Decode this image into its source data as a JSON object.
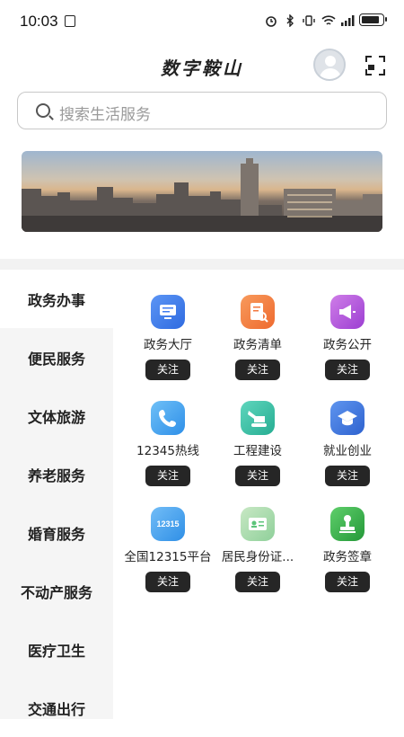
{
  "status": {
    "time": "10:03"
  },
  "header": {
    "title": "数字鞍山"
  },
  "search": {
    "placeholder": "搜索生活服务"
  },
  "sidebar": {
    "items": [
      {
        "label": "政务办事",
        "active": true
      },
      {
        "label": "便民服务"
      },
      {
        "label": "文体旅游"
      },
      {
        "label": "养老服务"
      },
      {
        "label": "婚育服务"
      },
      {
        "label": "不动产服务"
      },
      {
        "label": "医疗卫生"
      },
      {
        "label": "交通出行"
      }
    ]
  },
  "services": [
    {
      "label": "政务大厅",
      "follow": "关注",
      "icon": "monitor-icon",
      "color": "#3f7cf0"
    },
    {
      "label": "政务清单",
      "follow": "关注",
      "icon": "document-search-icon",
      "color": "#f2773e"
    },
    {
      "label": "政务公开",
      "follow": "关注",
      "icon": "megaphone-icon",
      "color": "#b04fd9"
    },
    {
      "label": "12345热线",
      "follow": "关注",
      "icon": "phone-icon",
      "color": "#41a3f0"
    },
    {
      "label": "工程建设",
      "follow": "关注",
      "icon": "excavator-icon",
      "color": "#35c2a5"
    },
    {
      "label": "就业创业",
      "follow": "关注",
      "icon": "graduation-cap-icon",
      "color": "#3f78e0"
    },
    {
      "label": "全国12315平台",
      "follow": "关注",
      "icon": "badge-12315-icon",
      "icon_text": "12315",
      "color": "#49a6f2"
    },
    {
      "label": "居民身份证...",
      "follow": "关注",
      "icon": "id-card-icon",
      "color": "#5cc47a"
    },
    {
      "label": "政务签章",
      "follow": "关注",
      "icon": "stamp-icon",
      "color": "#35a84a"
    }
  ]
}
